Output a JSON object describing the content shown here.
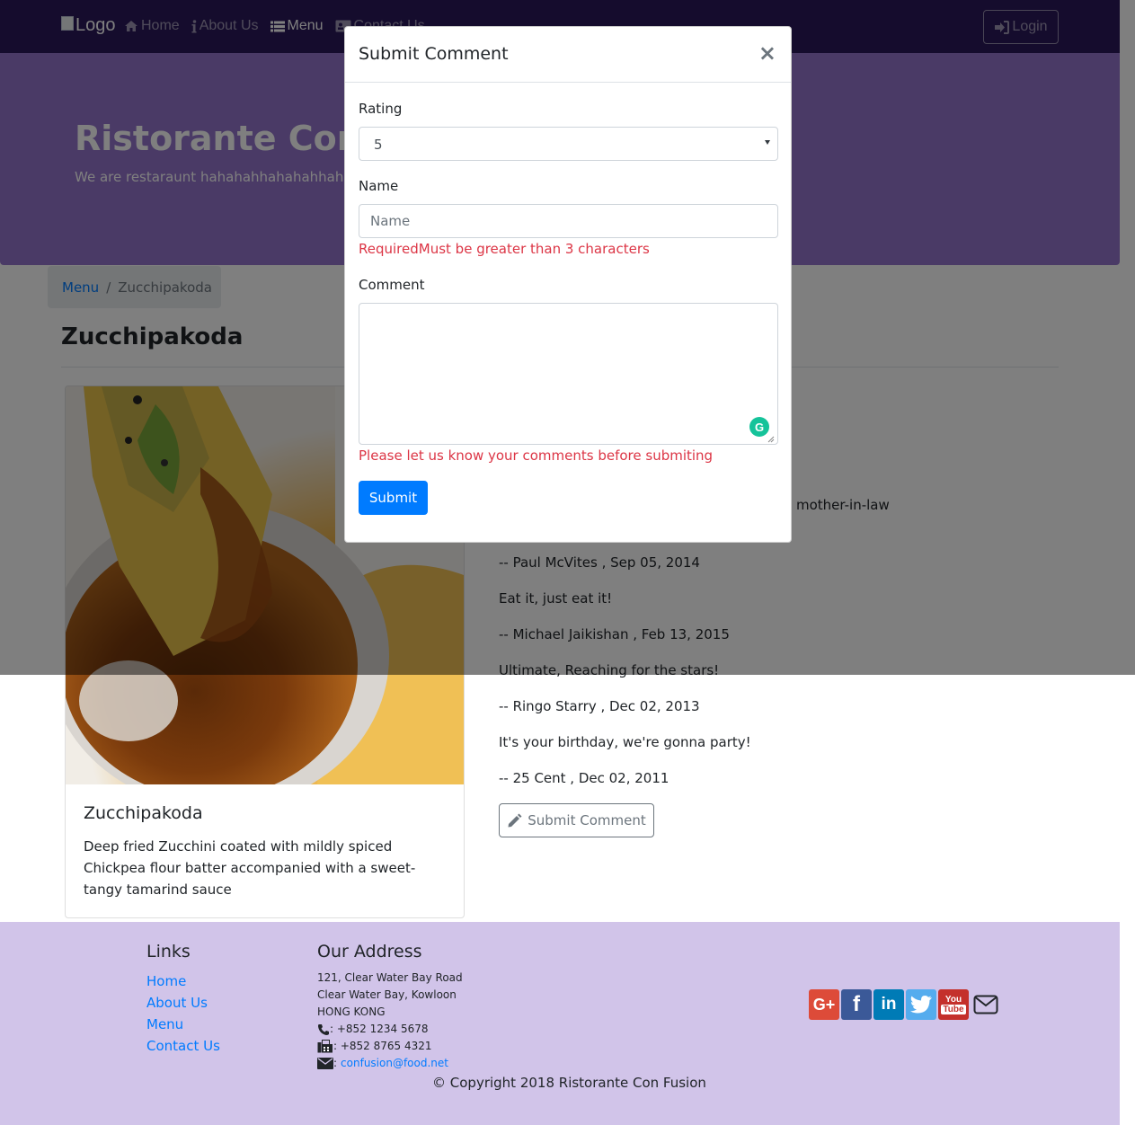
{
  "navbar": {
    "logo_alt": "Logo",
    "items": [
      {
        "label": "Home",
        "icon": "home-icon",
        "active": false
      },
      {
        "label": "About Us",
        "icon": "info-icon",
        "active": false
      },
      {
        "label": "Menu",
        "icon": "list-icon",
        "active": true
      },
      {
        "label": "Contact Us",
        "icon": "address-card-icon",
        "active": false
      }
    ],
    "login_label": "Login"
  },
  "jumbotron": {
    "title": "Ristorante Con Fusion",
    "subtitle": "We are restaraunt hahahahhahahahhaha"
  },
  "breadcrumb": {
    "link": "Menu",
    "separator": "/",
    "current": "Zucchipakoda"
  },
  "page_title": "Zucchipakoda",
  "dish": {
    "name": "Zucchipakoda",
    "description": "Deep fried Zucchini coated with mildly spiced Chickpea flour batter accompanied with a sweet-tangy tamarind sauce"
  },
  "comments": {
    "partial_visible": "mother-in-law",
    "items": [
      {
        "author_line": "-- Paul McVites , Sep 05, 2014"
      },
      {
        "text": "Eat it, just eat it!",
        "author_line": "-- Michael Jaikishan , Feb 13, 2015"
      },
      {
        "text": "Ultimate, Reaching for the stars!",
        "author_line": "-- Ringo Starry , Dec 02, 2013"
      },
      {
        "text": "It's your birthday, we're gonna party!",
        "author_line": "-- 25 Cent , Dec 02, 2011"
      }
    ],
    "submit_label": "Submit Comment"
  },
  "footer": {
    "links_heading": "Links",
    "links": [
      "Home",
      "About Us",
      "Menu",
      "Contact Us"
    ],
    "address_heading": "Our Address",
    "address_lines": [
      "121, Clear Water Bay Road",
      "Clear Water Bay, Kowloon",
      "HONG KONG"
    ],
    "phone": ": +852 1234 5678",
    "fax": ": +852 8765 4321",
    "email_prefix": ":",
    "email": "confusion@food.net",
    "social": [
      "google-plus",
      "facebook",
      "linkedin",
      "twitter",
      "youtube",
      "mail"
    ],
    "copyright": "© Copyright 2018 Ristorante Con Fusion"
  },
  "modal": {
    "title": "Submit Comment",
    "close_label": "×",
    "rating_label": "Rating",
    "rating_value": "5",
    "name_label": "Name",
    "name_placeholder": "Name",
    "name_error": "RequiredMust be greater than 3 characters",
    "comment_label": "Comment",
    "comment_error": "Please let us know your comments before submiting",
    "submit_label": "Submit"
  },
  "colors": {
    "navbar": "#2a185a",
    "jumbotron": "#9575cd",
    "footer": "#d1c4e9",
    "primary": "#007bff",
    "danger": "#dc3545"
  }
}
